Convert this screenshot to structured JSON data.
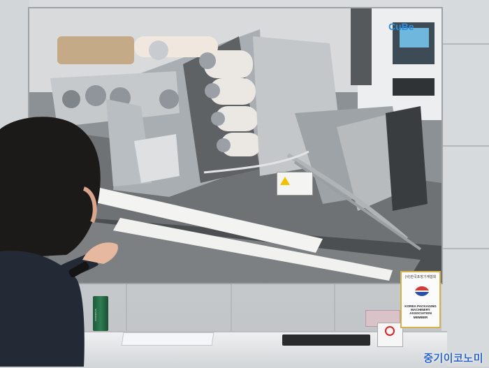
{
  "screen": {
    "logo_text": "CuBe",
    "warning_label": "",
    "colors": {
      "steel": "#b9bec2",
      "roller": "#e9e6e2",
      "belt": "#f2f2f0",
      "dark": "#3a3c3e"
    }
  },
  "badge": {
    "title": "(사)한국포장기계협회",
    "text": "KOREA PACKAGING MACHINERY ASSOCIATION MEMBER"
  },
  "cup": {
    "label": "STARBUCKS"
  },
  "watermark": {
    "text": "중기이코노미"
  }
}
